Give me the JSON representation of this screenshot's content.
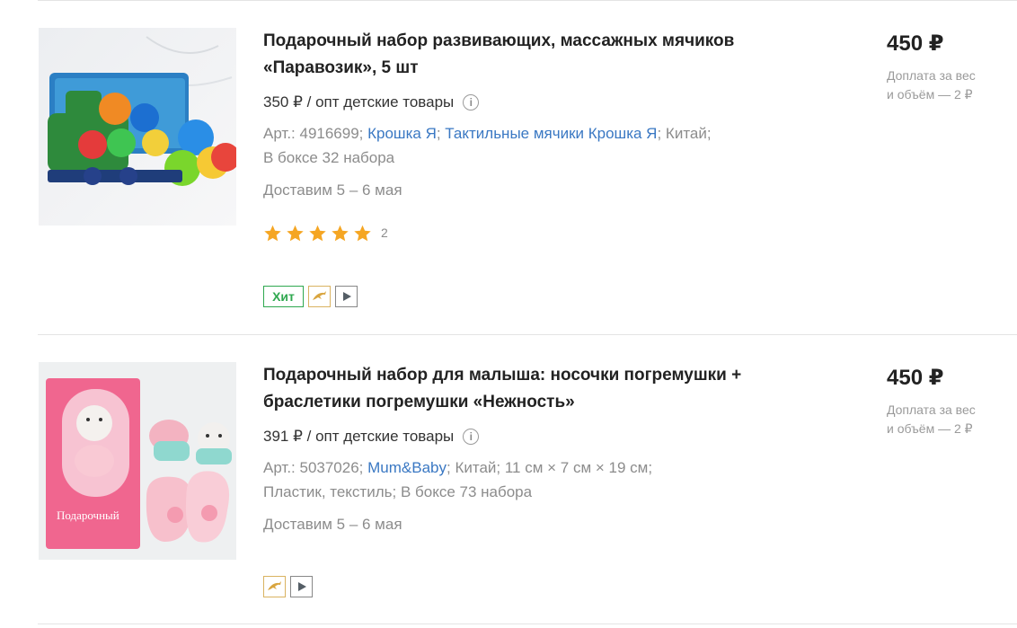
{
  "products": [
    {
      "title": "Подарочный набор развивающих, массажных мячиков «Паравозик», 5 шт",
      "opt_price": "350 ₽ / опт детские товары",
      "article_prefix": "Арт.: 4916699; ",
      "brand_link": "Крошка Я",
      "sep1": "; ",
      "category_link": "Тактильные мячики Крошка Я",
      "meta_suffix": "; Китай;",
      "meta_line2": "В боксе 32 набора",
      "delivery": "Доставим 5 – 6 мая",
      "rating_stars": 5,
      "rating_count": "2",
      "badge_hit": "Хит",
      "price": "450 ₽",
      "surcharge_line1": "Доплата за вес",
      "surcharge_line2": "и объём — 2 ₽"
    },
    {
      "title": "Подарочный набор для малыша: носочки погремушки + браслетики погремушки «Нежность»",
      "opt_price": "391 ₽ / опт детские товары",
      "article_prefix": "Арт.: 5037026; ",
      "brand_link": "Mum&Baby",
      "meta_suffix": "; Китай; 11 см × 7 см × 19 см;",
      "meta_line2": "Пластик, текстиль; В боксе 73 набора",
      "delivery": "Доставим 5 – 6 мая",
      "price": "450 ₽",
      "surcharge_line1": "Доплата за вес",
      "surcharge_line2": "и объём — 2 ₽"
    }
  ],
  "icons": {
    "info": "info-icon",
    "star": "star-icon",
    "dolphin": "dolphin-icon",
    "play": "play-icon"
  },
  "colors": {
    "link": "#3a78c3",
    "star": "#f5a623",
    "hit": "#2fa84f"
  }
}
